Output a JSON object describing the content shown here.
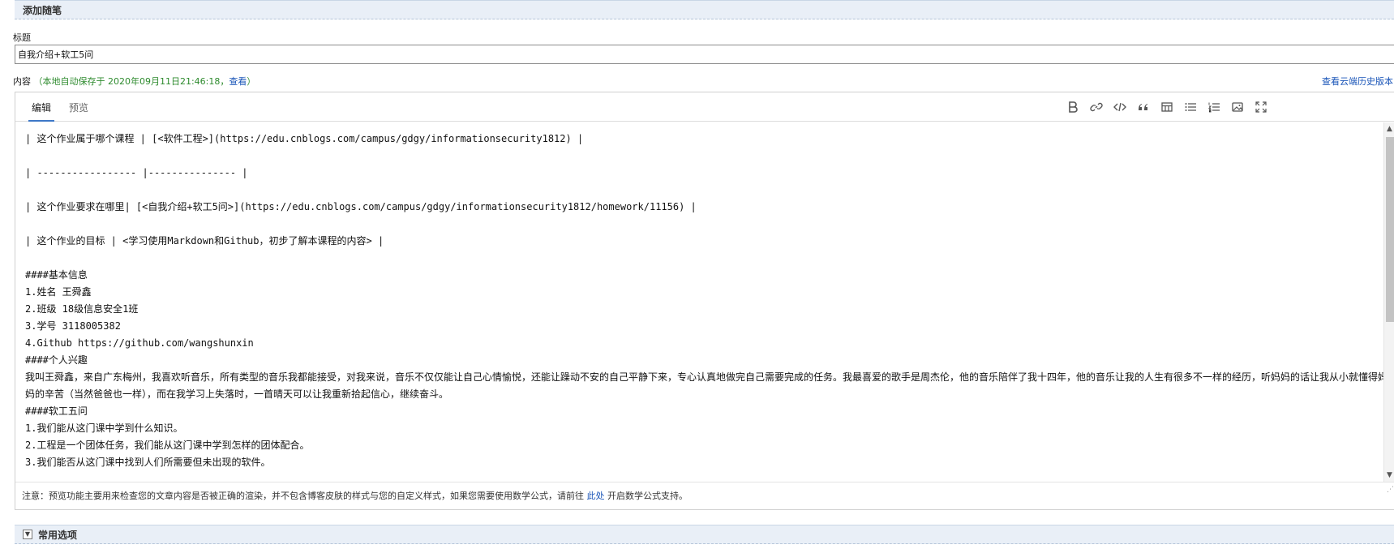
{
  "sections": {
    "add_note": "添加随笔",
    "common_options": "常用选项"
  },
  "title_field": {
    "label": "标题",
    "value": "自我介绍+软工5问"
  },
  "content_row": {
    "label": "内容",
    "autosave_open": "（本地自动保存于 2020年09月11日21:46:18，",
    "view_link": "查看",
    "autosave_close": "）",
    "cloud_history": "查看云端历史版本"
  },
  "editor": {
    "tabs": [
      "编辑",
      "预览"
    ],
    "toolbar_icons": [
      "bold-icon",
      "link-icon",
      "code-icon",
      "quote-icon",
      "table-icon",
      "bulleted-list-icon",
      "numbered-list-icon",
      "image-icon",
      "fullscreen-icon"
    ],
    "text": "| 这个作业属于哪个课程 | [<软件工程>](https://edu.cnblogs.com/campus/gdgy/informationsecurity1812) |\n\n| ----------------- |--------------- |\n\n| 这个作业要求在哪里| [<自我介绍+软工5问>](https://edu.cnblogs.com/campus/gdgy/informationsecurity1812/homework/11156) |\n\n| 这个作业的目标 | <学习使用Markdown和Github，初步了解本课程的内容> |\n\n####基本信息\n1.姓名 王舜鑫\n2.班级 18级信息安全1班\n3.学号 3118005382\n4.Github https://github.com/wangshunxin\n####个人兴趣\n我叫王舜鑫，来自广东梅州，我喜欢听音乐，所有类型的音乐我都能接受，对我来说，音乐不仅仅能让自己心情愉悦，还能让躁动不安的自己平静下来，专心认真地做完自己需要完成的任务。我最喜爱的歌手是周杰伦，他的音乐陪伴了我十四年，他的音乐让我的人生有很多不一样的经历，听妈妈的话让我从小就懂得妈妈的辛苦（当然爸爸也一样），而在我学习上失落时，一首晴天可以让我重新拾起信心，继续奋斗。\n####软工五问\n1.我们能从这门课中学到什么知识。\n2.工程是一个团体任务，我们能从这门课中学到怎样的团体配合。\n3.我们能否从这门课中找到人们所需要但未出现的软件。",
    "note_prefix": "注意：预览功能主要用来检查您的文章内容是否被正确的渲染，并不包含博客皮肤的样式与您的自定义样式，如果您需要使用数学公式，请前往",
    "note_link": "此处",
    "note_suffix": "开启数学公式支持。"
  }
}
